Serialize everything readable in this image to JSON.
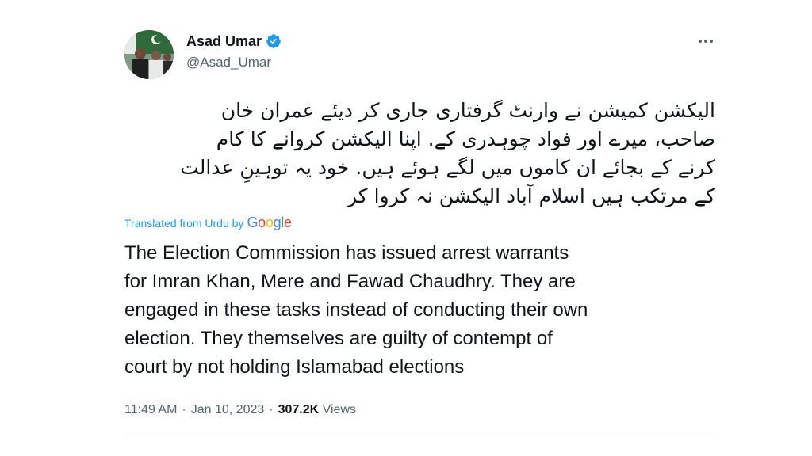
{
  "author": {
    "name": "Asad Umar",
    "handle": "@Asad_Umar",
    "verified": true
  },
  "tweet": {
    "urdu_lines": [
      "الیکشن کمیشن نے وارنٹ گرفتاری جاری کر دیئے عمران خان",
      "صاحب، میرے اور فواد چوہدری کے. اپنا الیکشن کروانے کا کام",
      "کرنے کے بجائے ان کاموں میں لگے ہوئے ہیں. خود یہ توہینِ عدالت",
      "کے مرتکب ہیں اسلام آباد الیکشن نہ کروا کر"
    ],
    "translated_label": "Translated from Urdu by",
    "google_logo": "Google",
    "translation_lines": [
      "The Election Commission has issued arrest warrants",
      "for Imran Khan, Mere and Fawad Chaudhry. They are",
      "engaged in these tasks instead of conducting their own",
      "election. They themselves are guilty of contempt of",
      "court by not holding Islamabad elections"
    ],
    "time": "11:49 AM",
    "date": "Jan 10, 2023",
    "separator": "·",
    "views_count": "307.2K",
    "views_label": "Views"
  },
  "icons": {
    "verified": "verified-badge-icon",
    "more": "more-options-icon"
  },
  "colors": {
    "verified": "#1d9bf0",
    "link": "#1d9bf0",
    "secondary_text": "#536471",
    "primary_text": "#0f1419"
  }
}
